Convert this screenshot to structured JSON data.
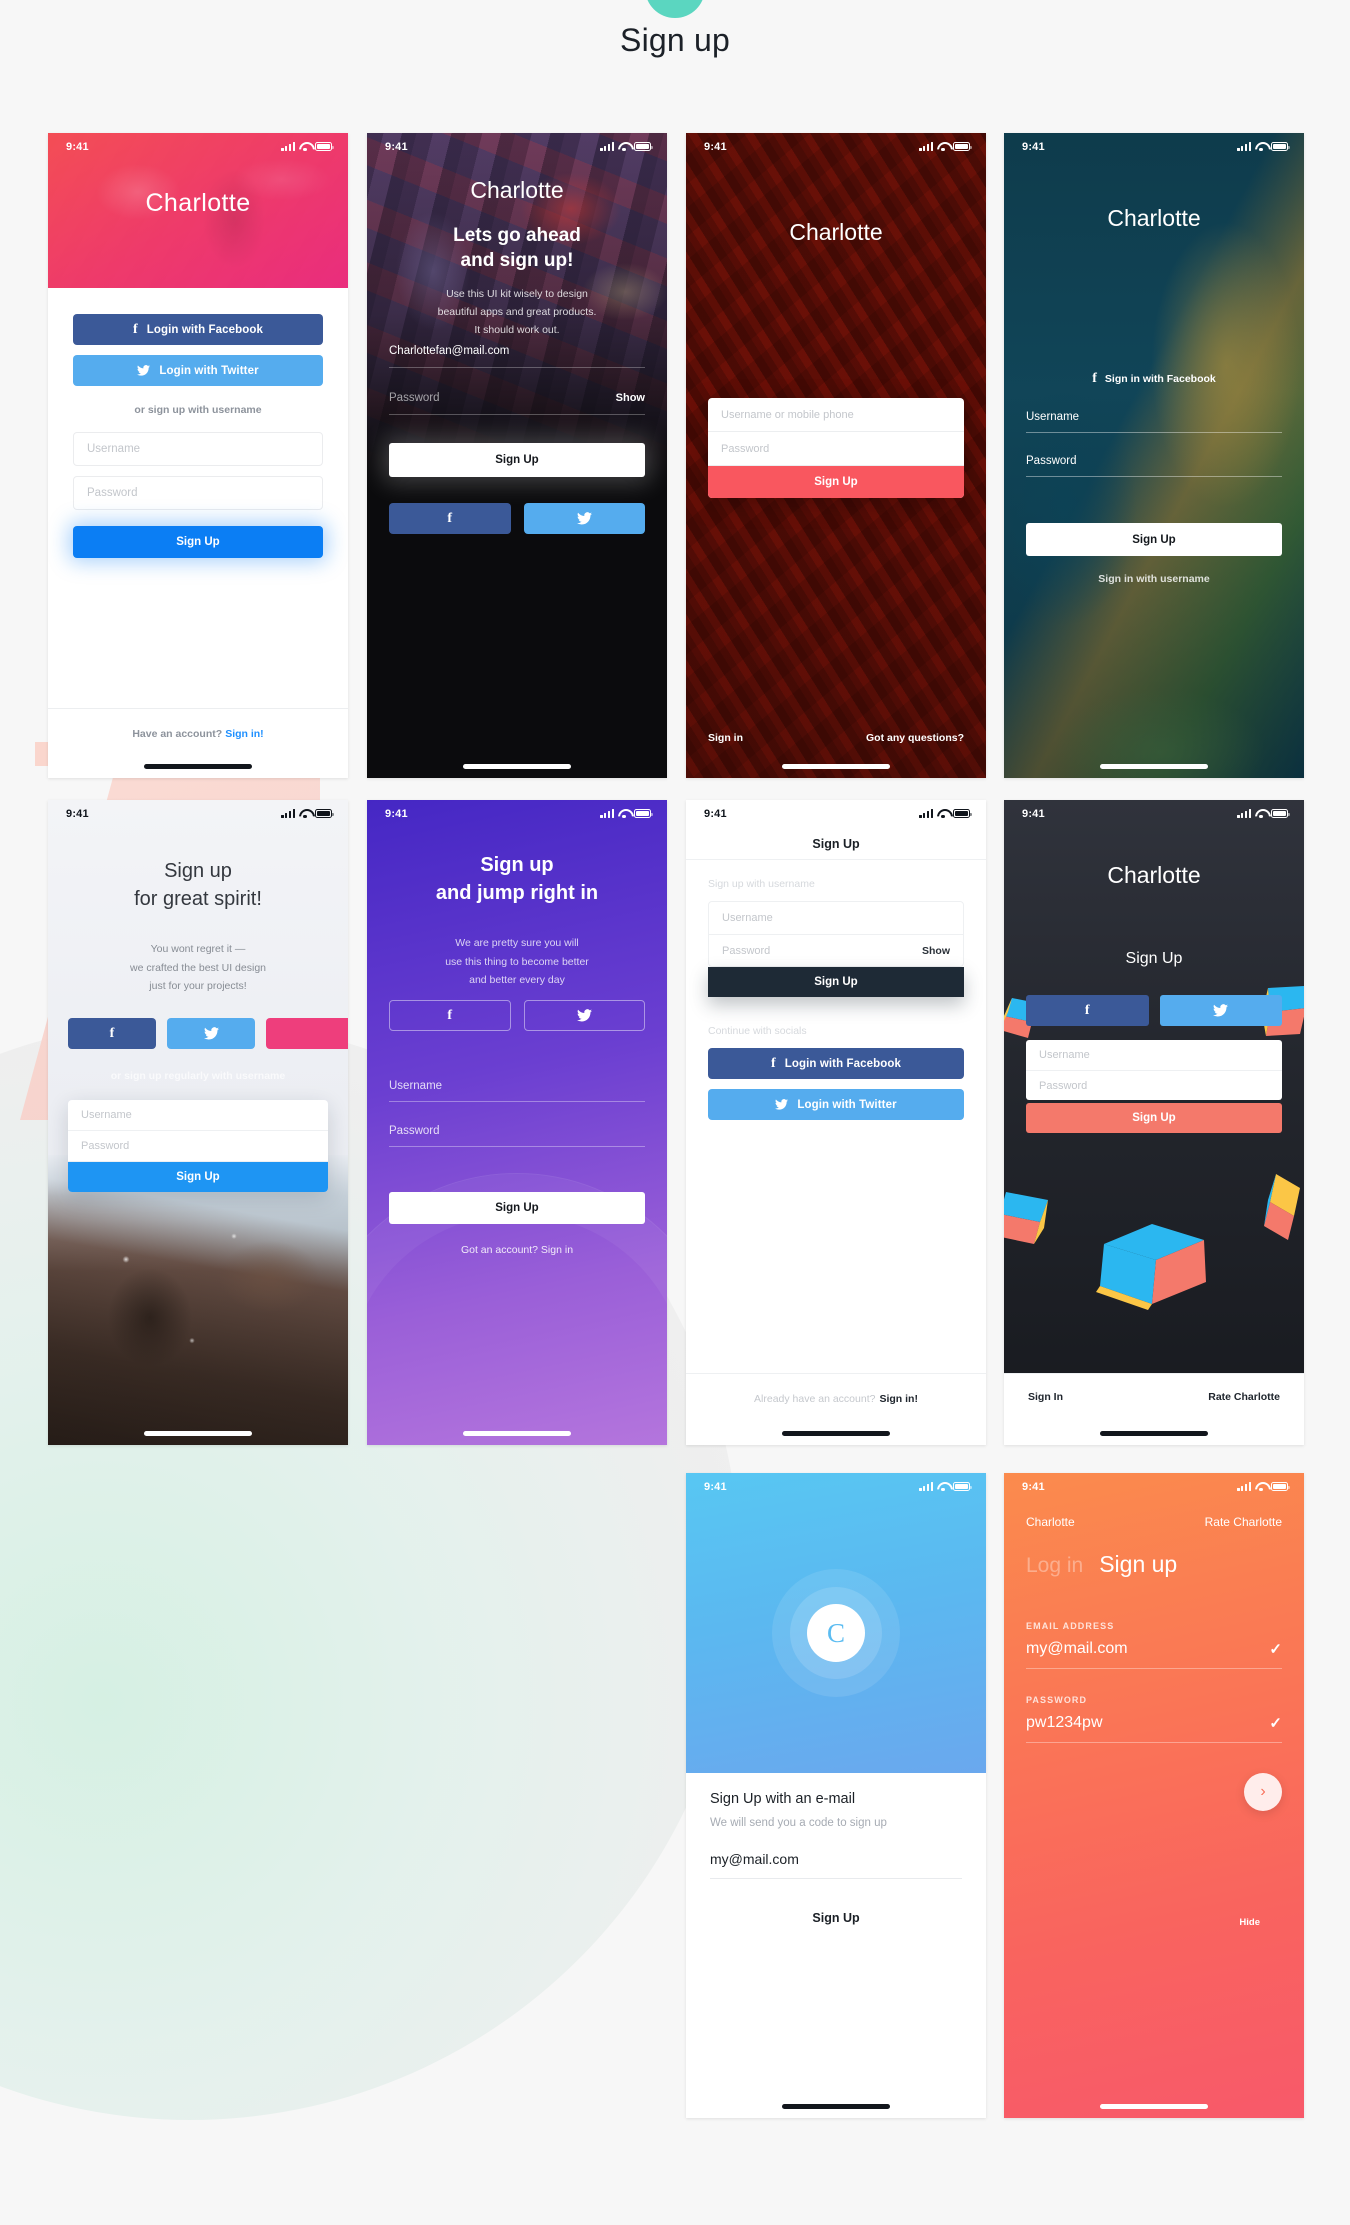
{
  "page": {
    "title": "Sign up",
    "status_time": "9:41"
  },
  "common": {
    "signup": "Sign Up",
    "signin": "Sign in",
    "username_ph": "Username",
    "password_ph": "Password",
    "show": "Show",
    "hide": "Hide",
    "facebook_icon": "f",
    "twitter_icon": "✓",
    "check_icon": "✓",
    "chevron_right_icon": "›"
  },
  "colors": {
    "facebook": "#3b5998",
    "twitter": "#55acee",
    "instagram": "#ee3e7c",
    "primary_blue": "#0b7ef4",
    "coral": "#f9575f",
    "salmon": "#f4796b",
    "dark": "#1e2a36",
    "link_blue": "#1f90ff"
  },
  "screens": [
    {
      "id": "screen-1-charlotte-pink",
      "status_time": "9:41",
      "brand": "Charlotte",
      "facebook_btn": "Login with Facebook",
      "twitter_btn": "Login with Twitter",
      "divider": "or sign up with username",
      "username_ph": "Username",
      "password_ph": "Password",
      "cta": "Sign Up",
      "footer_text": "Have an account?",
      "footer_link": "Sign in!"
    },
    {
      "id": "screen-2-lets-go-ahead",
      "status_time": "9:41",
      "brand": "Charlotte",
      "headline_1": "Lets go ahead",
      "headline_2": "and sign up!",
      "sub_1": "Use this UI kit wisely to design",
      "sub_2": "beautiful apps and great products.",
      "sub_3": "It should work out.",
      "email_value": "Charlottefan@mail.com",
      "password_ph": "Password",
      "show": "Show",
      "cta": "Sign Up",
      "facebook_icon": "f",
      "twitter_icon": "twitter-bird"
    },
    {
      "id": "screen-3-charlotte-canyon",
      "status_time": "9:41",
      "brand": "Charlotte",
      "username_ph": "Username or mobile phone",
      "password_ph": "Password",
      "cta": "Sign Up",
      "footer_left": "Sign in",
      "footer_right": "Got any questions?"
    },
    {
      "id": "screen-4-charlotte-coast",
      "status_time": "9:41",
      "brand": "Charlotte",
      "facebook_btn": "Sign in with Facebook",
      "username_label": "Username",
      "password_label": "Password",
      "cta": "Sign Up",
      "alt_link": "Sign in with username"
    },
    {
      "id": "screen-5-great-spirit",
      "status_time": "9:41",
      "headline_1": "Sign up",
      "headline_2": "for great spirit!",
      "sub_1": "You wont regret it —",
      "sub_2": "we crafted the best UI design",
      "sub_3": "just for your projects!",
      "divider": "or sign up regularly with username",
      "username_ph": "Username",
      "password_ph": "Password",
      "cta": "Sign Up"
    },
    {
      "id": "screen-6-jump-right-in",
      "status_time": "9:41",
      "headline_1": "Sign up",
      "headline_2": "and jump right in",
      "sub_1": "We are pretty sure you will",
      "sub_2": "use this thing to become better",
      "sub_3": "and better every day",
      "username_label": "Username",
      "password_label": "Password",
      "cta": "Sign Up",
      "footer": "Got an account? Sign in"
    },
    {
      "id": "screen-7-signup-light",
      "status_time": "9:41",
      "nav_title": "Sign Up",
      "section_1": "Sign up with username",
      "username_ph": "Username",
      "password_ph": "Password",
      "show": "Show",
      "cta": "Sign Up",
      "section_2": "Continue with socials",
      "facebook_btn": "Login with Facebook",
      "twitter_btn": "Login with Twitter",
      "footer_text": "Already have an account?",
      "footer_link": "Sign in!"
    },
    {
      "id": "screen-8-charlotte-dark",
      "status_time": "9:41",
      "brand": "Charlotte",
      "sub": "Sign Up",
      "username_ph": "Username",
      "password_ph": "Password",
      "cta": "Sign Up",
      "footer_left": "Sign In",
      "footer_right": "Rate Charlotte"
    },
    {
      "id": "screen-9-email-code",
      "status_time": "9:41",
      "logo_letter": "C",
      "headline": "Sign Up with an e-mail",
      "sub": "We will send you a code to sign up",
      "email_value": "my@mail.com",
      "cta": "Sign Up"
    },
    {
      "id": "screen-10-orange-signup",
      "status_time": "9:41",
      "brand": "Charlotte",
      "rate": "Rate Charlotte",
      "tab_inactive": "Log in",
      "tab_active": "Sign up",
      "email_label": "EMAIL ADDRESS",
      "email_value": "my@mail.com",
      "password_label": "PASSWORD",
      "password_value": "pw1234pw",
      "hide": "Hide",
      "next_icon": "›"
    }
  ]
}
